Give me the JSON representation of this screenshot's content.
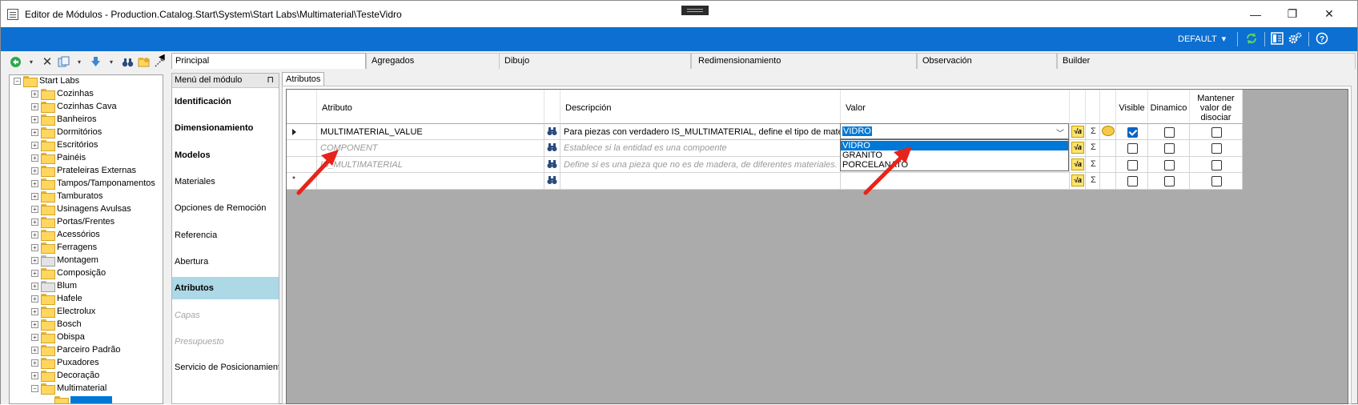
{
  "window": {
    "title": "Editor de Módulos - Production.Catalog.Start\\System\\Start Labs\\Multimaterial\\TesteVidro",
    "minimize": "—",
    "maximize": "❐",
    "close": "✕"
  },
  "toolbar": {
    "profile": "DEFAULT",
    "profile_arrow": "▾",
    "icons": [
      "refresh-icon",
      "layout-icon",
      "settings-icon",
      "help-icon"
    ]
  },
  "tree": {
    "toolbar_icons": [
      "back-icon",
      "delete-icon",
      "copy-icon",
      "move-icon",
      "find-icon",
      "folder-icon",
      "tools-icon"
    ],
    "root": "Start Labs",
    "items": [
      "Cozinhas",
      "Cozinhas Cava",
      "Banheiros",
      "Dormitórios",
      "Escritórios",
      "Painéis",
      "Prateleiras Externas",
      "Tampos/Tamponamentos",
      "Tamburatos",
      "Usinagens Avulsas",
      "Portas/Frentes",
      "Acessórios",
      "Ferragens",
      "Montagem",
      "Composição",
      "Blum",
      "Hafele",
      "Electrolux",
      "Bosch",
      "Obispa",
      "Parceiro Padrão",
      "Puxadores",
      "Decoração",
      "Multimaterial"
    ]
  },
  "tabs": [
    "Principal",
    "Agregados",
    "Dibujo",
    "Redimensionamiento",
    "Observación",
    "Builder"
  ],
  "menu": {
    "header": "Menú del módulo",
    "pin": "⊓",
    "items": [
      "Identificación",
      "Dimensionamiento",
      "Modelos",
      "Materiales",
      "Opciones de Remoción",
      "Referencia",
      "Abertura",
      "Atributos",
      "Capas",
      "Presupuesto",
      "Servicio de Posicionamiento"
    ]
  },
  "attributes": {
    "tab": "Atributos",
    "headers": {
      "attribute": "Atributo",
      "description": "Descripción",
      "value": "Valor",
      "visible": "Visible",
      "dynamic": "Dinamico",
      "keep_line1": "Mantener",
      "keep_line2": "valor de",
      "keep_line3": "disociar"
    },
    "rows": [
      {
        "attribute": "MULTIMATERIAL_VALUE",
        "description": "Para piezas con verdadero IS_MULTIMATERIAL, define el tipo de material",
        "value": "VIDRO",
        "visible": true,
        "dynamic": false,
        "keep": false
      },
      {
        "attribute": "COMPONENT",
        "description": "Establece si la entidad es una compoente",
        "value": "",
        "visible": false,
        "dynamic": false,
        "keep": false
      },
      {
        "attribute": "IS_MULTIMATERIAL",
        "description": "Define si es una pieza que no es de madera, de diferentes materiales. Se re...",
        "value": "",
        "visible": false,
        "dynamic": false,
        "keep": false
      }
    ],
    "new_row_marker": "*",
    "fx_label": "√a",
    "sigma": "Σ",
    "binoculars": "🔭"
  },
  "dropdown": {
    "selected": "VIDRO",
    "options": [
      "VIDRO",
      "GRANITO",
      "PORCELANATO"
    ]
  },
  "colors": {
    "accent": "#0d6fd1",
    "selection": "#0078d7",
    "menu_active": "#add8e6",
    "annotation": "#e8231a"
  }
}
